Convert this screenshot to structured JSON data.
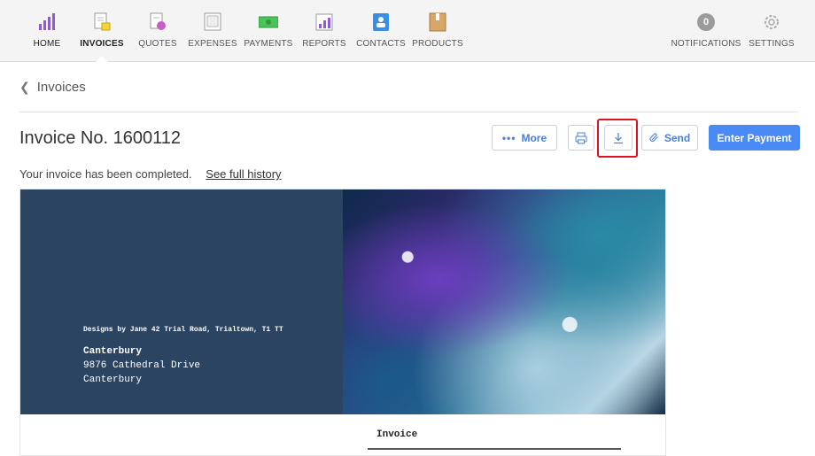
{
  "nav": {
    "items": [
      {
        "label": "HOME",
        "icon": "home-bar-chart-icon",
        "active": false
      },
      {
        "label": "INVOICES",
        "icon": "invoices-icon",
        "active": true
      },
      {
        "label": "QUOTES",
        "icon": "quotes-icon",
        "active": false
      },
      {
        "label": "EXPENSES",
        "icon": "expenses-icon",
        "active": false
      },
      {
        "label": "PAYMENTS",
        "icon": "payments-icon",
        "active": false
      },
      {
        "label": "REPORTS",
        "icon": "reports-icon",
        "active": false
      },
      {
        "label": "CONTACTS",
        "icon": "contacts-icon",
        "active": false
      },
      {
        "label": "PRODUCTS",
        "icon": "products-icon",
        "active": false
      }
    ],
    "notifications": {
      "label": "NOTIFICATIONS",
      "count": "0"
    },
    "settings": {
      "label": "SETTINGS",
      "icon": "gear-icon"
    }
  },
  "breadcrumb": {
    "label": "Invoices"
  },
  "page": {
    "title": "Invoice No. 1600112",
    "status": "Your invoice has been completed.",
    "history_link": "See full history"
  },
  "actions": {
    "more": "More",
    "print_icon": "printer-icon",
    "download_icon": "download-icon",
    "send": "Send",
    "enter_payment": "Enter Payment"
  },
  "preview": {
    "sender": "Designs by Jane 42 Trial Road, Trialtown, T1 TT",
    "recipient_name": "Canterbury",
    "recipient_line1": "9876 Cathedral Drive",
    "recipient_line2": "Canterbury",
    "heading": "Invoice"
  },
  "colors": {
    "accent": "#4a8af4",
    "nav_bg": "#f4f4f5",
    "invoice_header": "#2b4461",
    "highlight": "#e0121f"
  }
}
